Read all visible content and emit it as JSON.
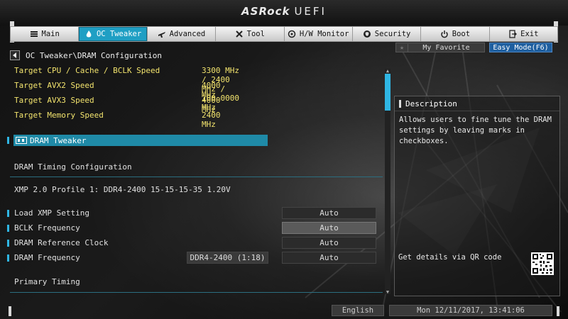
{
  "header": {
    "brand": "ASRock",
    "product": "UEFI"
  },
  "tabs": [
    {
      "label": "Main",
      "icon": "menu-icon"
    },
    {
      "label": "OC Tweaker",
      "icon": "flame-icon",
      "active": true
    },
    {
      "label": "Advanced",
      "icon": "airplane-icon"
    },
    {
      "label": "Tool",
      "icon": "tools-icon"
    },
    {
      "label": "H/W Monitor",
      "icon": "monitor-icon"
    },
    {
      "label": "Security",
      "icon": "shield-icon"
    },
    {
      "label": "Boot",
      "icon": "power-icon"
    },
    {
      "label": "Exit",
      "icon": "exit-icon"
    }
  ],
  "breadcrumb": "OC Tweaker\\DRAM Configuration",
  "targets": [
    {
      "label": "Target CPU / Cache / BCLK Speed",
      "value": "3300 MHz / 2400 MHz / 100.0000 MHz"
    },
    {
      "label": "Target AVX2 Speed",
      "value": "4000 MHz"
    },
    {
      "label": "Target AVX3 Speed",
      "value": "4000 MHz"
    },
    {
      "label": "Target Memory Speed",
      "value": "2400 MHz"
    }
  ],
  "dram_tweaker": "DRAM Tweaker",
  "timing_config": "DRAM Timing Configuration",
  "xmp_info": "XMP 2.0 Profile 1: DDR4-2400 15-15-15-35 1.20V",
  "settings": [
    {
      "label": "Load XMP Setting",
      "value": "Auto"
    },
    {
      "label": "BCLK Frequency",
      "value": "Auto"
    },
    {
      "label": "DRAM Reference Clock",
      "value": "Auto"
    },
    {
      "label": "DRAM Frequency",
      "value": "Auto",
      "extra": "DDR4-2400 (1:18)"
    }
  ],
  "primary_timing": "Primary Timing",
  "right": {
    "favorite": "My Favorite",
    "easy_mode": "Easy Mode(F6)",
    "description_title": "Description",
    "description_lines": [
      "Allows users to fine tune the DRAM",
      "settings by leaving marks in checkboxes."
    ],
    "qr_text": "Get details via QR code"
  },
  "footer": {
    "language": "English",
    "datetime": "Mon 12/11/2017, 13:41:06"
  },
  "colors": {
    "accent": "#1f9fc4",
    "highlight_text": "#f2e36d",
    "easy_mode": "#1e5fa0"
  }
}
